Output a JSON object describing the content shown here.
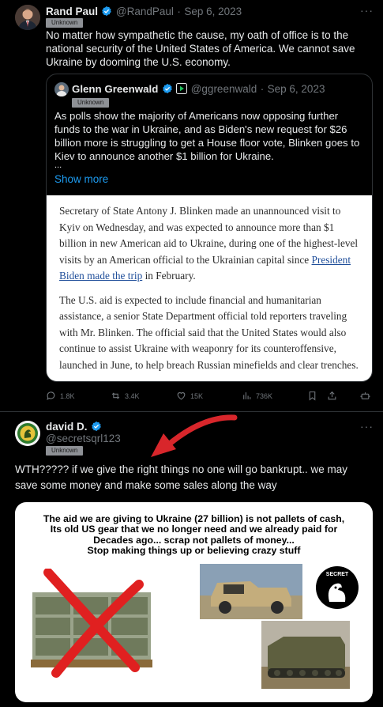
{
  "tweet1": {
    "display_name": "Rand Paul",
    "handle": "@RandPaul",
    "date": "Sep 6, 2023",
    "badge": "Unknown",
    "text": "No matter how sympathetic the cause, my oath of office is to the national security of the United States of America. We cannot save Ukraine by dooming the U.S. economy.",
    "more": "···"
  },
  "quote": {
    "display_name": "Glenn Greenwald",
    "handle": "@ggreenwald",
    "date": "Sep 6, 2023",
    "badge": "Unknown",
    "text": "As polls show the majority of Americans now opposing further funds to the war in Ukraine, and as Biden's new request for $26 billion more is struggling to get a House floor vote, Blinken goes to Kiev to announce another $1 billion for Ukraine.",
    "ellipsis": "...",
    "show_more": "Show more",
    "article_p1_before": "Secretary of State Antony J. Blinken made an unannounced visit to Kyiv on Wednesday, and was expected to announce more than $1 billion in new American aid to Ukraine, during one of the highest-level visits by an American official to the Ukrainian capital since ",
    "article_p1_link": "President Biden made the trip",
    "article_p1_after": " in February.",
    "article_p2": "The U.S. aid is expected to include financial and humanitarian assistance, a senior State Department official told reporters traveling with Mr. Blinken. The official said that the United States would also continue to assist Ukraine with weaponry for its counteroffensive, launched in June, to help breach Russian minefields and clear trenches."
  },
  "actions": {
    "replies": "1.8K",
    "reposts": "3.4K",
    "likes": "15K",
    "views": "736K"
  },
  "tweet2": {
    "display_name": "david D.",
    "handle": "@secretsqrl123",
    "badge": "Unknown",
    "text": "WTH????? if we give the right things no one will go bankrupt.. we may save some money and make some sales along the way",
    "more": "···"
  },
  "meme": {
    "line1": "The aid we are giving to Ukraine (27 billion) is not pallets of cash,",
    "line2": "Its old US gear that we no longer need and we already paid for",
    "line3": "Decades ago... scrap not pallets of money...",
    "line4": "Stop making things up or believing crazy stuff",
    "logo_text": "SECRET"
  },
  "colors": {
    "background": "#000000",
    "accent": "#1d9bf0",
    "muted": "#71767b",
    "arrow": "#d8262b"
  }
}
